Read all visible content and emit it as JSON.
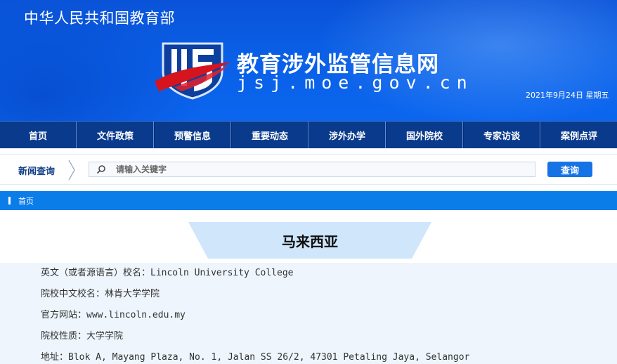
{
  "header": {
    "ministry": "中华人民共和国教育部",
    "site_title": "教育涉外监管信息网",
    "site_domain": "jsj.moe.gov.cn",
    "date": "2021年9月24日  星期五"
  },
  "nav": {
    "items": [
      "首页",
      "文件政策",
      "预警信息",
      "重要动态",
      "涉外办学",
      "国外院校",
      "专家访谈",
      "案例点评"
    ]
  },
  "search": {
    "label": "新闻查询",
    "placeholder": "请输入关键字",
    "button": "查询"
  },
  "breadcrumb": {
    "home": "首页"
  },
  "content": {
    "country": "马来西亚",
    "lines": [
      "英文（或者源语言）校名：Lincoln University College",
      "院校中文校名：林肯大学学院",
      "官方网站：www.lincoln.edu.my",
      "院校性质：大学学院",
      "地址：Blok A, Mayang Plaza, No. 1, Jalan SS 26/2, 47301 Petaling Jaya, Selangor"
    ]
  },
  "colors": {
    "banner": "#0a5fe6",
    "nav": "#0a3a8c",
    "accent": "#1673e6",
    "breadcrumb": "#0b7de9",
    "content_bg": "#eef5fc"
  },
  "icons": {
    "logo": "shield-logo-icon",
    "search": "search-icon",
    "separator": "chevron-separator-icon"
  }
}
